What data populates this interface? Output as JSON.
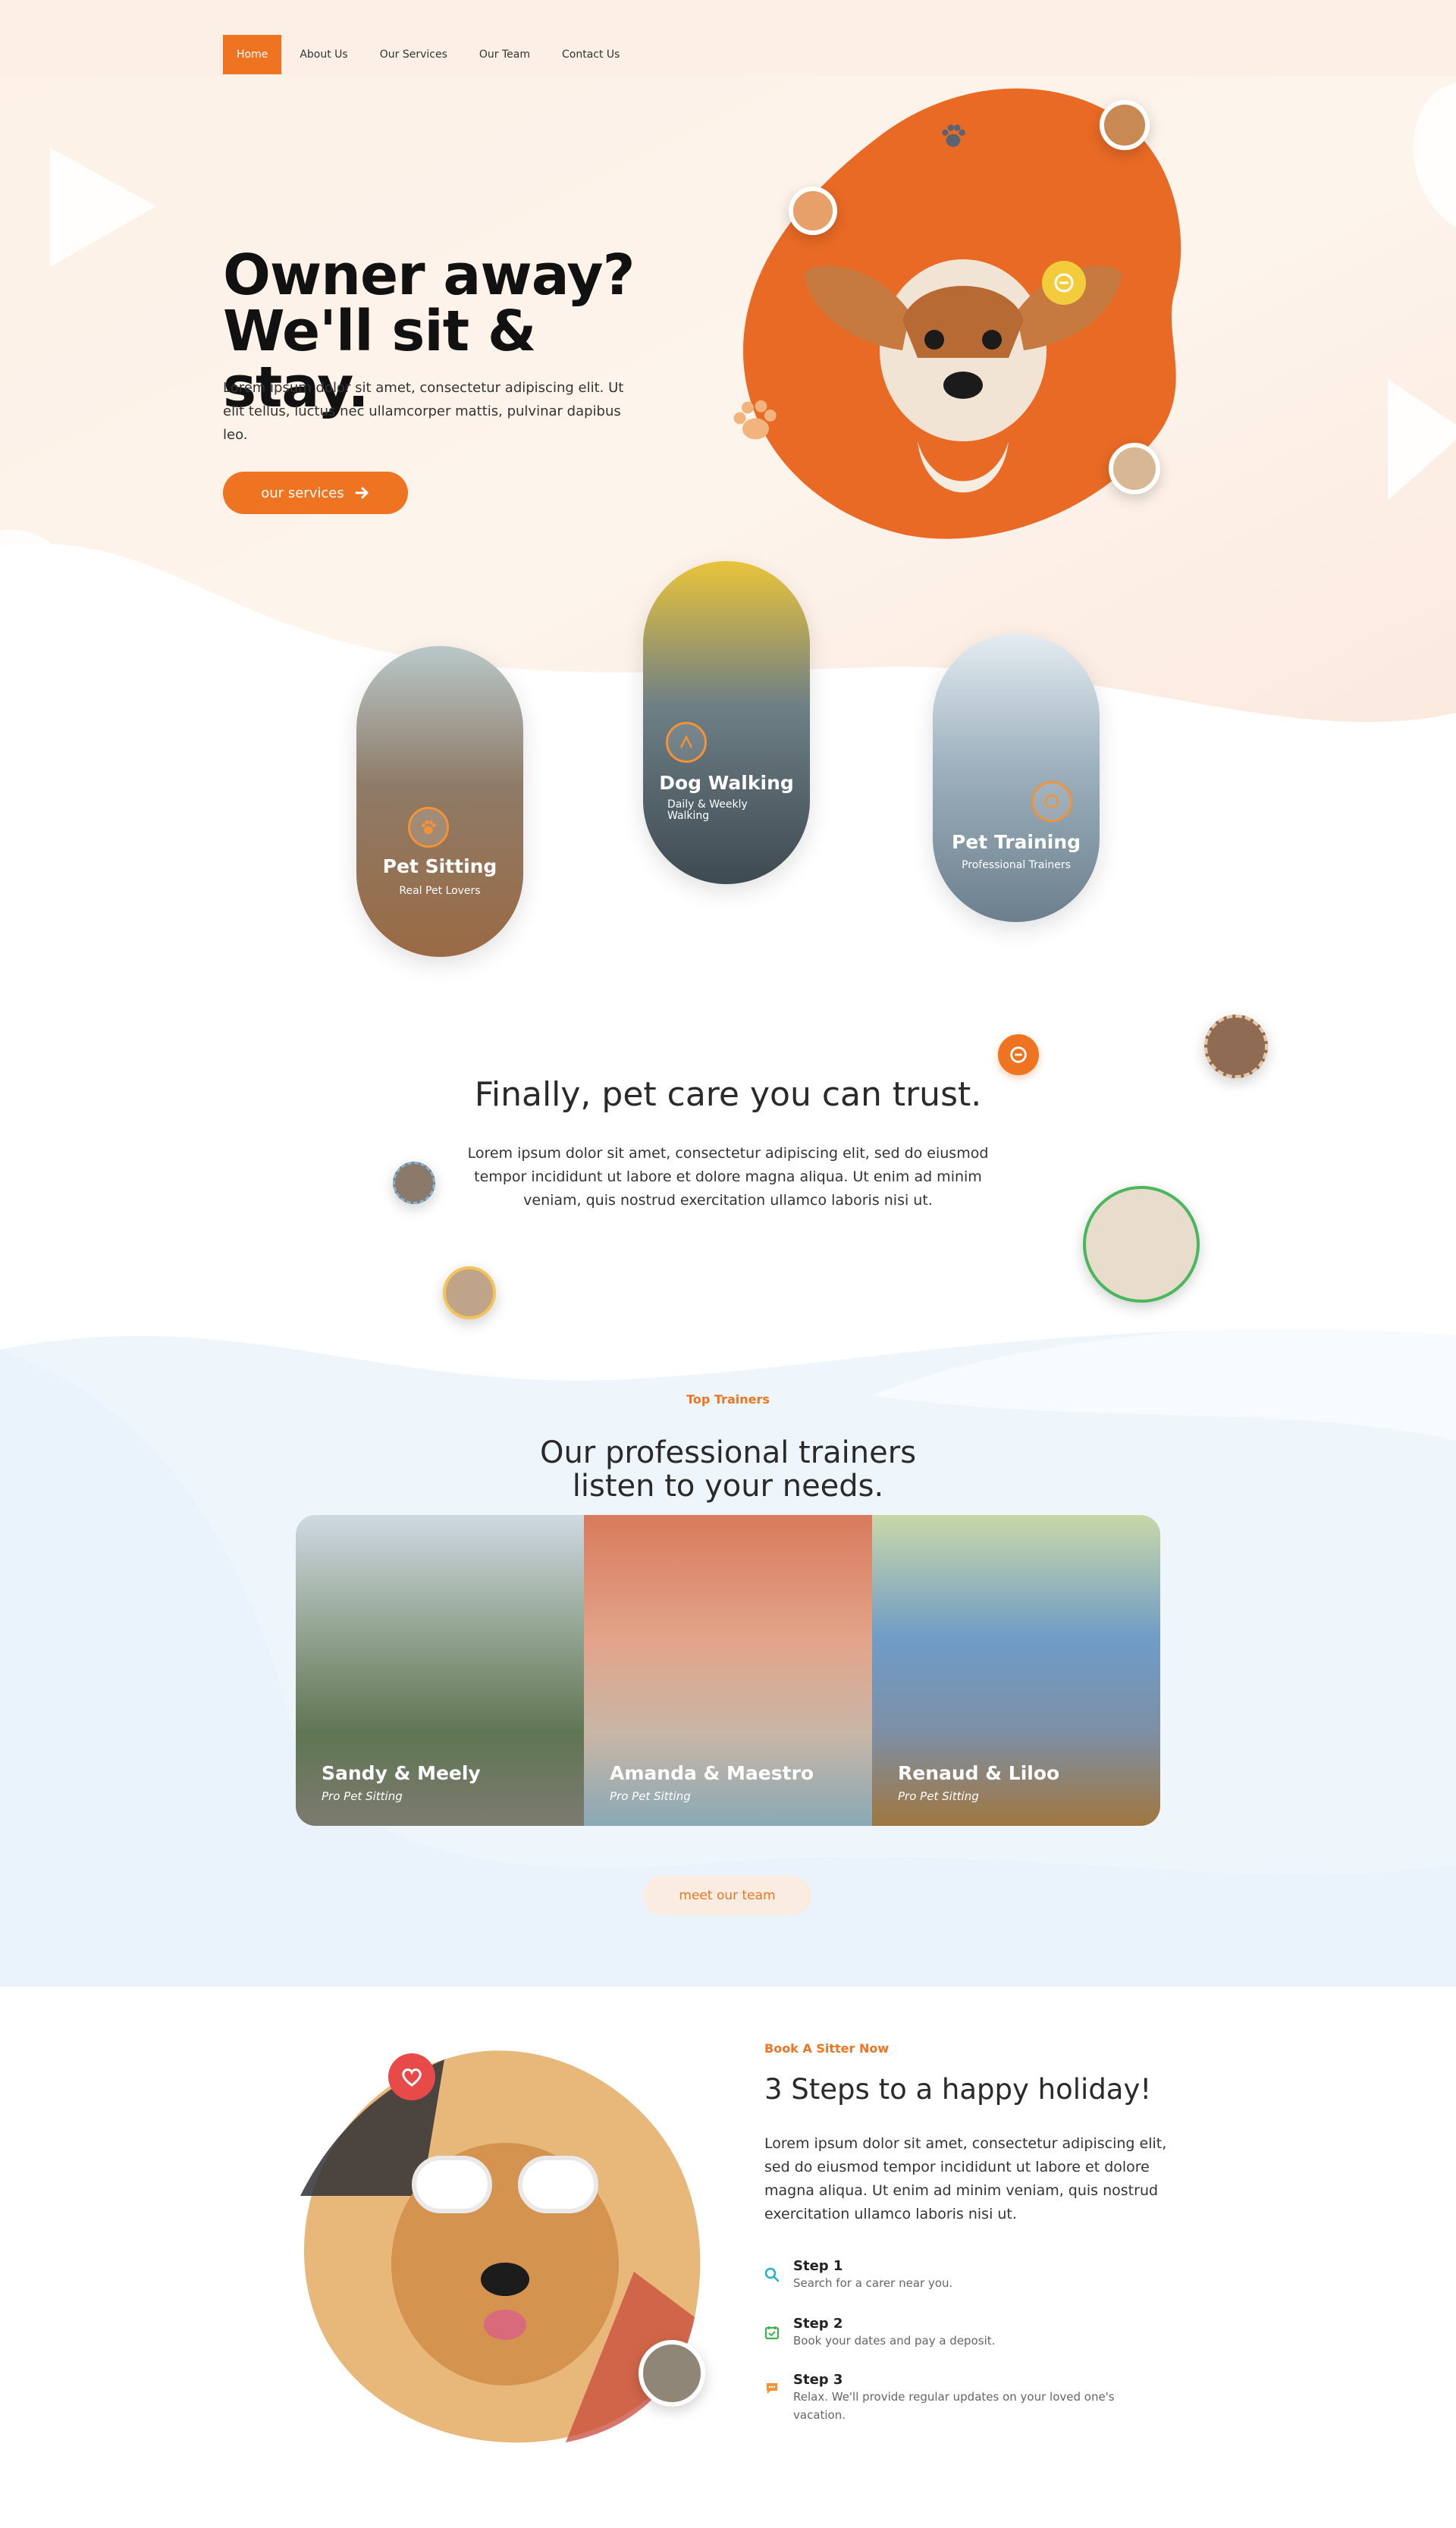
{
  "nav": {
    "items": [
      {
        "label": "Home",
        "active": true
      },
      {
        "label": "About Us",
        "active": false
      },
      {
        "label": "Our Services",
        "active": false
      },
      {
        "label": "Our Team",
        "active": false
      },
      {
        "label": "Contact Us",
        "active": false
      }
    ]
  },
  "hero": {
    "title_line1": "Owner away?",
    "title_line2": "We'll sit & stay.",
    "subtitle": "Lorem ipsum dolor sit amet, consectetur adipiscing elit. Ut elit tellus, luctus nec ullamcorper mattis, pulvinar dapibus leo.",
    "button_label": "our services"
  },
  "services": [
    {
      "title": "Pet Sitting",
      "subtitle": "Real Pet Lovers"
    },
    {
      "title": "Dog Walking",
      "subtitle": "Daily & Weekly Walking"
    },
    {
      "title": "Pet Training",
      "subtitle": "Professional Trainers"
    }
  ],
  "trust": {
    "title": "Finally, pet care you can trust.",
    "text": "Lorem ipsum dolor sit amet, consectetur adipiscing elit, sed do eiusmod tempor incididunt ut labore et dolore magna aliqua. Ut enim ad minim veniam, quis nostrud exercitation ullamco laboris nisi ut."
  },
  "trainers": {
    "eyebrow": "Top Trainers",
    "title_line1": "Our professional trainers",
    "title_line2": "listen to your needs.",
    "cards": [
      {
        "name": "Sandy & Meely",
        "role": "Pro Pet Sitting"
      },
      {
        "name": "Amanda & Maestro",
        "role": "Pro Pet Sitting"
      },
      {
        "name": "Renaud & Liloo",
        "role": "Pro Pet Sitting"
      }
    ],
    "button_label": "meet our team"
  },
  "booking": {
    "eyebrow": "Book A Sitter Now",
    "title": "3 Steps to a happy holiday!",
    "text": "Lorem ipsum dolor sit amet, consectetur adipiscing elit, sed do eiusmod tempor incididunt ut labore et dolore magna aliqua. Ut enim ad minim veniam, quis nostrud exercitation ullamco laboris nisi ut.",
    "steps": [
      {
        "title": "Step 1",
        "text": "Search for a carer near you.",
        "icon": "search-icon",
        "color": "#2ab0c4"
      },
      {
        "title": "Step 2",
        "text": "Book your dates and pay a deposit.",
        "icon": "calendar-icon",
        "color": "#3cb54a"
      },
      {
        "title": "Step 3",
        "text": "Relax. We'll provide regular updates on your loved one's vacation.",
        "icon": "chat-icon",
        "color": "#f39236"
      }
    ]
  },
  "colors": {
    "accent": "#ef7422",
    "heading": "#111111",
    "soft_orange": "#fbece2",
    "soft_blue": "#eaf4fc"
  }
}
